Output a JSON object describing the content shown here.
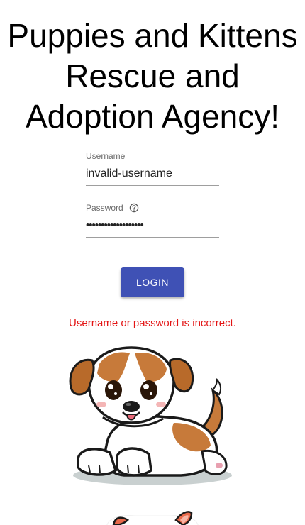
{
  "page": {
    "title": "Puppies and Kittens Rescue and Adoption Agency!"
  },
  "form": {
    "username_label": "Username",
    "username_value": "invalid-username",
    "password_label": "Password",
    "password_value": "•••••••••••••••••••",
    "login_label": "LOGIN",
    "error_message": "Username or password is incorrect."
  },
  "icons": {
    "password_help": "help-circle-icon"
  },
  "images": {
    "puppy": "puppy-illustration",
    "kitten": "kitten-illustration"
  },
  "colors": {
    "primary": "#3f51b5",
    "error": "#e31414",
    "label": "#6b6b6b"
  }
}
